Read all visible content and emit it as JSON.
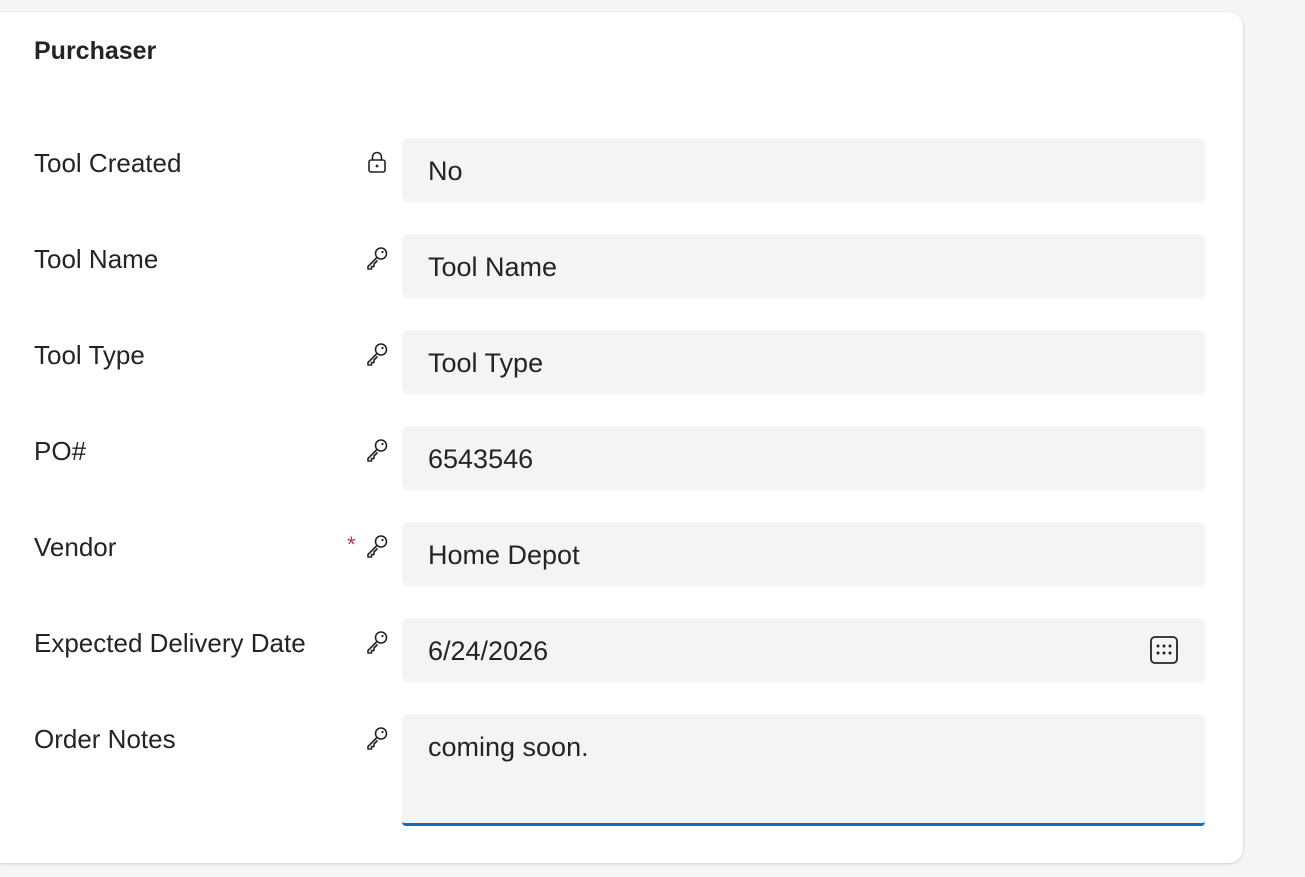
{
  "section": {
    "title": "Purchaser"
  },
  "fields": [
    {
      "label": "Tool Created",
      "value": "No",
      "icon": "lock-icon"
    },
    {
      "label": "Tool Name",
      "value": "Tool Name",
      "icon": "key-icon"
    },
    {
      "label": "Tool Type",
      "value": "Tool Type",
      "icon": "key-icon"
    },
    {
      "label": "PO#",
      "value": "6543546",
      "icon": "key-icon"
    },
    {
      "label": "Vendor",
      "value": "Home Depot",
      "icon": "key-icon",
      "required_marker": "*"
    },
    {
      "label": "Expected Delivery Date",
      "value": "6/24/2026",
      "icon": "key-icon",
      "action_icon": "calendar-icon"
    },
    {
      "label": "Order Notes",
      "value": "coming soon.",
      "icon": "key-icon"
    }
  ],
  "colors": {
    "accent": "#0f6cbd",
    "required": "#c4314b",
    "field_background": "#f4f4f4",
    "card_background": "#ffffff",
    "page_background": "#f5f5f5"
  }
}
